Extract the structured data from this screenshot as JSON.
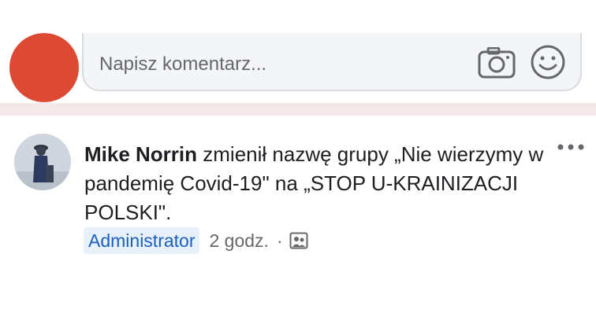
{
  "comment_input": {
    "placeholder": "Napisz komentarz..."
  },
  "post": {
    "author": "Mike Norrin",
    "text_part1": "zmienił nazwę grupy „Nie wierzymy w pandemię Covid-19\" na „STOP U-KRAINIZACJI POLSKI\".",
    "badge": "Administrator",
    "time": "2 godz.",
    "separator": "·"
  },
  "icons": {
    "camera": "camera-icon",
    "smiley": "smiley-icon",
    "more": "more-options-icon",
    "group": "group-icon"
  },
  "colors": {
    "badge_text": "#1b5fbf",
    "badge_bg": "#e7f0fb",
    "self_avatar": "#dd4a33",
    "divider": "#f4e8e8"
  }
}
